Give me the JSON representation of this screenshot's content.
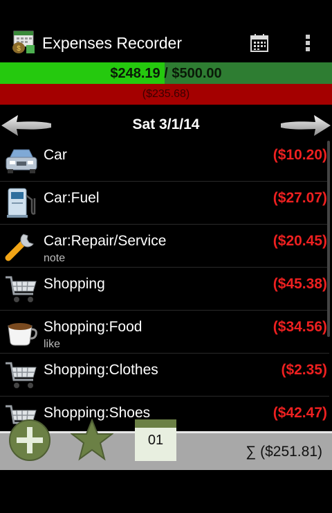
{
  "app": {
    "title": "Expenses Recorder"
  },
  "budget": {
    "spent": "$248.19",
    "limit": "$500.00",
    "separator": " / ",
    "fill_fraction": 0.4964,
    "remaining": "($235.68)"
  },
  "date": {
    "label": "Sat 3/1/14"
  },
  "expenses": [
    {
      "category": "Car",
      "amount": "($10.20)",
      "note": "",
      "icon": "car-icon"
    },
    {
      "category": "Car:Fuel",
      "amount": "($27.07)",
      "note": "",
      "icon": "fuel-pump-icon"
    },
    {
      "category": "Car:Repair/Service",
      "amount": "($20.45)",
      "note": "note",
      "icon": "wrench-icon"
    },
    {
      "category": "Shopping",
      "amount": "($45.38)",
      "note": "",
      "icon": "cart-icon"
    },
    {
      "category": "Shopping:Food",
      "amount": "($34.56)",
      "note": "like",
      "icon": "coffee-cup-icon"
    },
    {
      "category": "Shopping:Clothes",
      "amount": "($2.35)",
      "note": "",
      "icon": "cart-icon"
    },
    {
      "category": "Shopping:Shoes",
      "amount": "($42.47)",
      "note": "",
      "icon": "cart-icon"
    }
  ],
  "footer": {
    "day": "01",
    "total": "∑ ($251.81)"
  },
  "colors": {
    "budget_fill": "#25c90e",
    "remaining": "#a40000",
    "amount": "#ee2020",
    "footer": "#a8a8a8",
    "icon_green": "#6b8045"
  }
}
